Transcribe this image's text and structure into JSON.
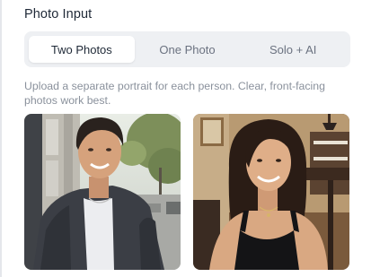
{
  "section": {
    "title": "Photo Input"
  },
  "modes": {
    "options": [
      {
        "label": "Two Photos",
        "active": true
      },
      {
        "label": "One Photo",
        "active": false
      },
      {
        "label": "Solo + AI",
        "active": false
      }
    ]
  },
  "hint": {
    "text": "Upload a separate portrait for each person. Clear, front-facing photos work best."
  },
  "colors": {
    "control_bg": "#eef0f3",
    "active_bg": "#ffffff",
    "muted_text": "#8a919c"
  },
  "icons": {
    "photo_1": "portrait-photo-man",
    "photo_2": "portrait-photo-woman"
  }
}
